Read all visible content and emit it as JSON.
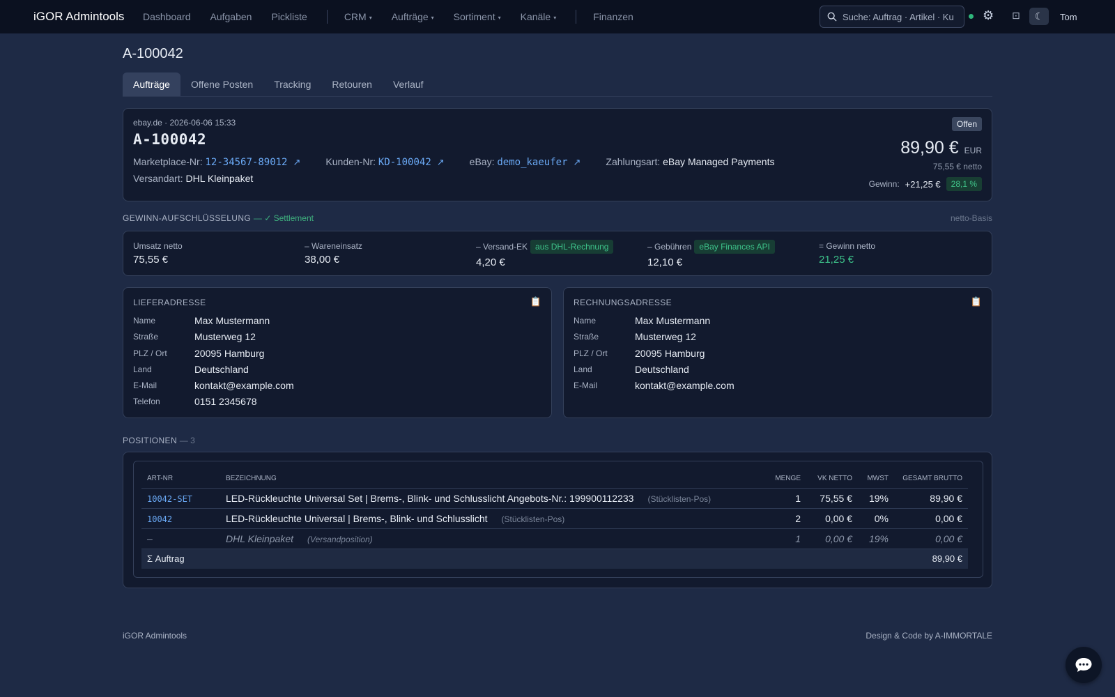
{
  "nav": {
    "brand": "iGOR Admintools",
    "links": [
      "Dashboard",
      "Aufgaben",
      "Pickliste"
    ],
    "dropdowns": [
      "CRM",
      "Aufträge",
      "Sortiment",
      "Kanäle"
    ],
    "finance": "Finanzen",
    "search_placeholder": "Suche: Auftrag · Artikel · Kunde",
    "user": "Tom",
    "colors": {
      "status_dot": "#2fb67c"
    }
  },
  "page": {
    "title": "A-100042",
    "tabs": [
      "Aufträge",
      "Offene Posten",
      "Tracking",
      "Retouren",
      "Verlauf"
    ]
  },
  "order": {
    "channel_date": "ebay.de · 2026-06-06 15:33",
    "id": "A-100042",
    "status": "Offen",
    "marketplace_label": "Marketplace-Nr:",
    "marketplace_no": "12-34567-89012",
    "customer_label": "Kunden-Nr:",
    "customer_no": "KD-100042",
    "ebay_label": "eBay:",
    "ebay_user": "demo_kaeufer",
    "payment_label": "Zahlungsart:",
    "payment": "eBay Managed Payments",
    "shipping_label": "Versandart:",
    "shipping": "DHL Kleinpaket",
    "total": "89,90 €",
    "currency": "EUR",
    "netto": "75,55 €",
    "netto_suffix": "netto",
    "profit_label": "Gewinn:",
    "profit": "+21,25 €",
    "profit_pct": "28,1 %"
  },
  "breakdown": {
    "title": "GEWINN-AUFSCHLÜSSELUNG",
    "status": "— ✓ Settlement",
    "basis": "netto-Basis",
    "items": [
      {
        "label": "Umsatz netto",
        "value": "75,55 €",
        "tag": ""
      },
      {
        "label": "– Wareneinsatz",
        "value": "38,00 €",
        "tag": ""
      },
      {
        "label": "– Versand-EK",
        "value": "4,20 €",
        "tag": "aus DHL-Rechnung"
      },
      {
        "label": "– Gebühren",
        "value": "12,10 €",
        "tag": "eBay Finances API"
      },
      {
        "label": "= Gewinn netto",
        "value": "21,25 €",
        "tag": ""
      }
    ]
  },
  "shipping_address": {
    "title": "LIEFERADRESSE",
    "rows": [
      {
        "k": "Name",
        "v": "Max Mustermann"
      },
      {
        "k": "Straße",
        "v": "Musterweg 12"
      },
      {
        "k": "PLZ / Ort",
        "v": "20095 Hamburg"
      },
      {
        "k": "Land",
        "v": "Deutschland"
      },
      {
        "k": "E-Mail",
        "v": "kontakt@example.com"
      },
      {
        "k": "Telefon",
        "v": "0151 2345678"
      }
    ]
  },
  "billing_address": {
    "title": "RECHNUNGSADRESSE",
    "rows": [
      {
        "k": "Name",
        "v": "Max Mustermann"
      },
      {
        "k": "Straße",
        "v": "Musterweg 12"
      },
      {
        "k": "PLZ / Ort",
        "v": "20095 Hamburg"
      },
      {
        "k": "Land",
        "v": "Deutschland"
      },
      {
        "k": "E-Mail",
        "v": "kontakt@example.com"
      }
    ]
  },
  "positions": {
    "title": "POSITIONEN",
    "count": "— 3",
    "headers": [
      "ART-NR",
      "BEZEICHNUNG",
      "MENGE",
      "VK NETTO",
      "MWST",
      "GESAMT BRUTTO"
    ],
    "rows": [
      {
        "art": "10042-SET",
        "name": "LED-Rückleuchte Universal Set | Brems-, Blink- und Schlusslicht Angebots-Nr.: 199900112233",
        "note": "(Stücklisten-Pos)",
        "qty": "1",
        "vk": "75,55 €",
        "mwst": "19%",
        "total": "89,90 €"
      },
      {
        "art": "10042",
        "name": "LED-Rückleuchte Universal | Brems-, Blink- und Schlusslicht",
        "note": "(Stücklisten-Pos)",
        "qty": "2",
        "vk": "0,00 €",
        "mwst": "0%",
        "total": "0,00 €"
      },
      {
        "art": "–",
        "name": "DHL Kleinpaket",
        "note": "(Versandposition)",
        "qty": "1",
        "vk": "0,00 €",
        "mwst": "19%",
        "total": "0,00 €"
      }
    ],
    "sum_label": "Σ Auftrag",
    "sum_total": "89,90 €"
  },
  "footer": {
    "left": "iGOR Admintools",
    "right": "Design & Code by A-IMMORTALE"
  },
  "icons": [
    "search-icon",
    "gear-icon",
    "layout-icon",
    "moon-icon",
    "external-link-icon",
    "clipboard-icon",
    "chat-icon"
  ]
}
